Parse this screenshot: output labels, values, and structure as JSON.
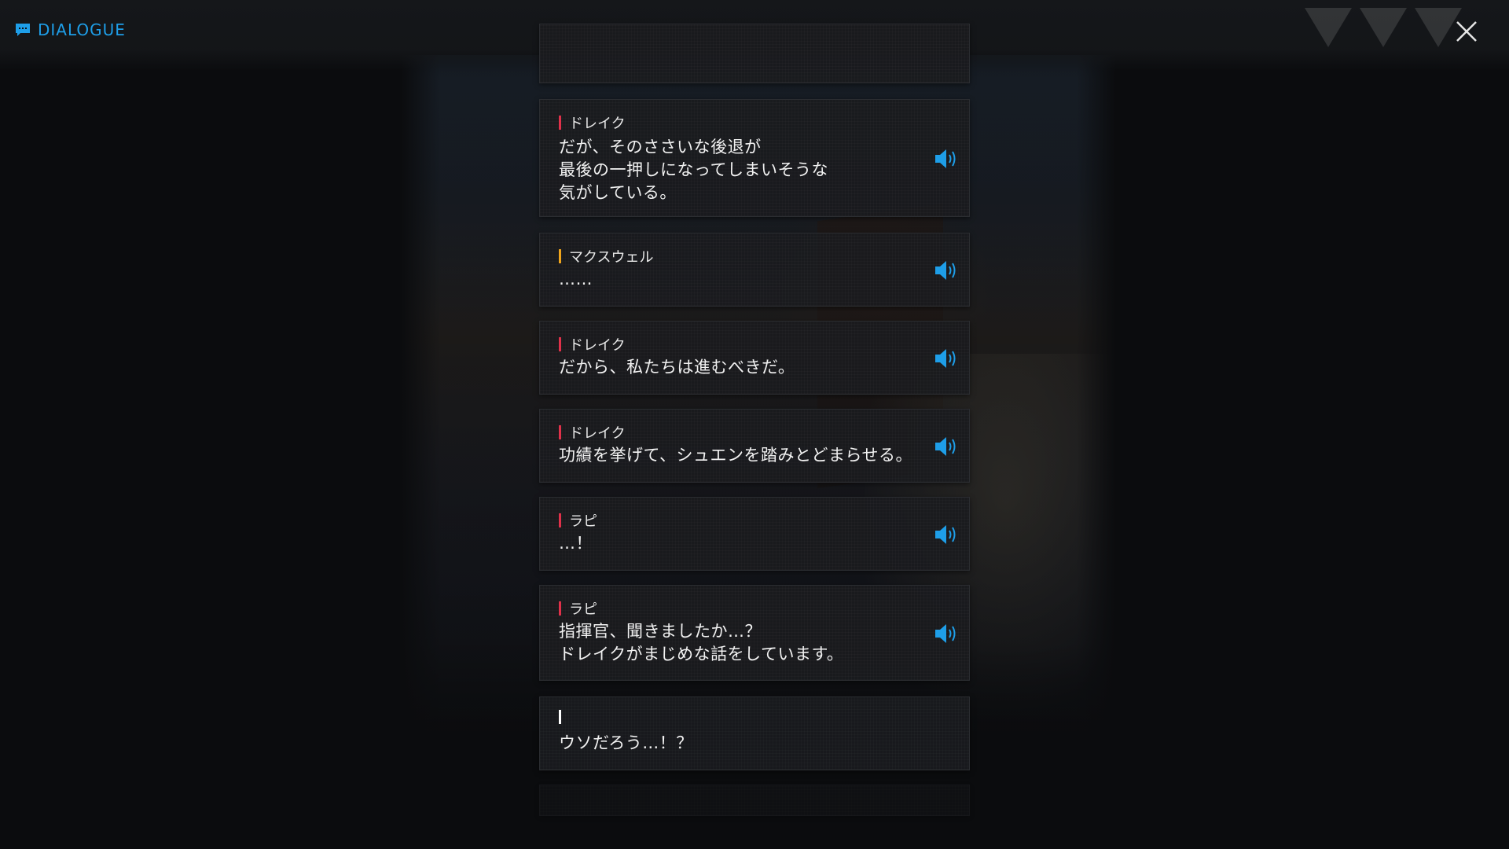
{
  "header": {
    "title": "DIALOGUE",
    "accent_color": "#1e9ee8",
    "title_icon": "chat-bubble-icon",
    "close_icon": "close-icon"
  },
  "dialogue": [
    {
      "speaker": "ドレイク",
      "speaker_color": "#e0314a",
      "text": "だが、そのささいな後退が\n最後の一押しになってしまいそうな\n気がしている。",
      "voice_icon": "speaker-icon"
    },
    {
      "speaker": "マクスウェル",
      "speaker_color": "#f0a51c",
      "text": "……",
      "voice_icon": "speaker-icon"
    },
    {
      "speaker": "ドレイク",
      "speaker_color": "#e0314a",
      "text": "だから、私たちは進むべきだ。",
      "voice_icon": "speaker-icon"
    },
    {
      "speaker": "ドレイク",
      "speaker_color": "#e0314a",
      "text": "功績を挙げて、シュエンを踏みとどまらせる。",
      "voice_icon": "speaker-icon"
    },
    {
      "speaker": "ラピ",
      "speaker_color": "#e0314a",
      "text": "…！",
      "voice_icon": "speaker-icon"
    },
    {
      "speaker": "ラピ",
      "speaker_color": "#e0314a",
      "text": "指揮官、聞きましたか…？\nドレイクがまじめな話をしています。",
      "voice_icon": "speaker-icon"
    },
    {
      "speaker": "",
      "speaker_color": "#ffffff",
      "text": "ウソだろう…！？"
    }
  ]
}
